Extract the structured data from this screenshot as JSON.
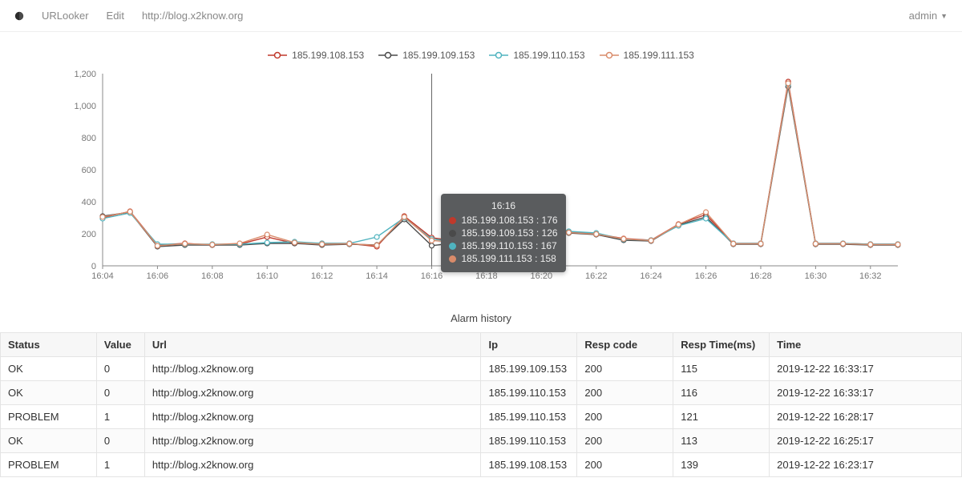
{
  "nav": {
    "app_name": "URLooker",
    "edit": "Edit",
    "url": "http://blog.x2know.org",
    "user": "admin"
  },
  "colors": {
    "s1": "#c0392b",
    "s2": "#4a4a4a",
    "s3": "#4fb3bf",
    "s4": "#d98b6a"
  },
  "chart_data": {
    "type": "line",
    "xlabel": "",
    "ylabel": "",
    "ylim": [
      0,
      1200
    ],
    "x_ticks": [
      "16:04",
      "16:06",
      "16:08",
      "16:10",
      "16:12",
      "16:14",
      "16:16",
      "16:18",
      "16:20",
      "16:22",
      "16:24",
      "16:26",
      "16:28",
      "16:30",
      "16:32"
    ],
    "y_ticks": [
      0,
      200,
      400,
      600,
      800,
      1000,
      1200
    ],
    "categories": [
      "16:04",
      "16:05",
      "16:06",
      "16:07",
      "16:08",
      "16:09",
      "16:10",
      "16:11",
      "16:12",
      "16:13",
      "16:14",
      "16:15",
      "16:16",
      "16:17",
      "16:18",
      "16:19",
      "16:20",
      "16:21",
      "16:22",
      "16:23",
      "16:24",
      "16:25",
      "16:26",
      "16:27",
      "16:28",
      "16:29",
      "16:30",
      "16:31",
      "16:32",
      "16:33"
    ],
    "series": [
      {
        "name": "185.199.108.153",
        "color_key": "s1",
        "values": [
          300,
          340,
          130,
          140,
          130,
          135,
          180,
          140,
          140,
          140,
          120,
          310,
          176,
          150,
          145,
          140,
          290,
          210,
          200,
          170,
          160,
          260,
          320,
          140,
          140,
          1150,
          140,
          140,
          135,
          135
        ]
      },
      {
        "name": "185.199.109.153",
        "color_key": "s2",
        "values": [
          310,
          335,
          120,
          130,
          130,
          130,
          140,
          140,
          130,
          135,
          130,
          290,
          126,
          145,
          140,
          135,
          270,
          205,
          195,
          160,
          155,
          255,
          305,
          135,
          135,
          1120,
          135,
          135,
          130,
          130
        ]
      },
      {
        "name": "185.199.110.153",
        "color_key": "s3",
        "values": [
          295,
          330,
          135,
          135,
          135,
          135,
          145,
          150,
          140,
          140,
          180,
          300,
          167,
          150,
          145,
          145,
          280,
          215,
          205,
          165,
          160,
          250,
          295,
          140,
          140,
          1135,
          140,
          140,
          135,
          135
        ]
      },
      {
        "name": "185.199.111.153",
        "color_key": "s4",
        "values": [
          305,
          338,
          125,
          138,
          132,
          140,
          195,
          145,
          135,
          138,
          128,
          305,
          158,
          148,
          142,
          138,
          285,
          208,
          198,
          168,
          158,
          258,
          335,
          138,
          138,
          1140,
          138,
          138,
          133,
          133
        ]
      }
    ],
    "tooltip": {
      "x": "16:16",
      "rows": [
        {
          "label": "185.199.108.153",
          "value": 176,
          "color_key": "s1"
        },
        {
          "label": "185.199.109.153",
          "value": 126,
          "color_key": "s2"
        },
        {
          "label": "185.199.110.153",
          "value": 167,
          "color_key": "s3"
        },
        {
          "label": "185.199.111.153",
          "value": 158,
          "color_key": "s4"
        }
      ]
    }
  },
  "alarm": {
    "title": "Alarm history",
    "headers": [
      "Status",
      "Value",
      "Url",
      "Ip",
      "Resp code",
      "Resp Time(ms)",
      "Time"
    ],
    "rows": [
      {
        "status": "OK",
        "value": "0",
        "url": "http://blog.x2know.org",
        "ip": "185.199.109.153",
        "resp_code": "200",
        "resp_time": "115",
        "time": "2019-12-22 16:33:17"
      },
      {
        "status": "OK",
        "value": "0",
        "url": "http://blog.x2know.org",
        "ip": "185.199.110.153",
        "resp_code": "200",
        "resp_time": "116",
        "time": "2019-12-22 16:33:17"
      },
      {
        "status": "PROBLEM",
        "value": "1",
        "url": "http://blog.x2know.org",
        "ip": "185.199.110.153",
        "resp_code": "200",
        "resp_time": "121",
        "time": "2019-12-22 16:28:17"
      },
      {
        "status": "OK",
        "value": "0",
        "url": "http://blog.x2know.org",
        "ip": "185.199.110.153",
        "resp_code": "200",
        "resp_time": "113",
        "time": "2019-12-22 16:25:17"
      },
      {
        "status": "PROBLEM",
        "value": "1",
        "url": "http://blog.x2know.org",
        "ip": "185.199.108.153",
        "resp_code": "200",
        "resp_time": "139",
        "time": "2019-12-22 16:23:17"
      }
    ]
  }
}
